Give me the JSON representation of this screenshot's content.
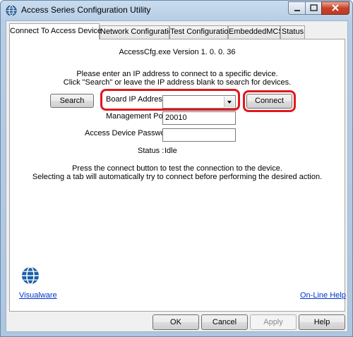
{
  "window": {
    "title": "Access Series Configuration Utility"
  },
  "tabs": [
    {
      "label": "Connect To Access Device"
    },
    {
      "label": "Network Configuration"
    },
    {
      "label": "Test Configuration"
    },
    {
      "label": "EmbeddedMCS"
    },
    {
      "label": "Status"
    }
  ],
  "connect": {
    "version": "AccessCfg.exe Version 1. 0. 0. 36",
    "instructions_1": "Please enter an IP address to connect to a specific device.",
    "instructions_2": "Click \"Search\" or leave the IP address blank to search for devices.",
    "search_label": "Search",
    "board_ip_label": "Board IP Address :",
    "board_ip_value": "",
    "connect_label": "Connect",
    "mgmt_port_label": "Management Port :",
    "mgmt_port_value": "20010",
    "password_label": "Access Device Password :",
    "password_value": "",
    "status_label": "Status :",
    "status_value": "Idle",
    "note_1": "Press the connect button to test the connection to the device.",
    "note_2": "Selecting a tab will automatically try to connect before performing the desired action.",
    "visualware_link": "Visualware",
    "help_link": "On-Line Help"
  },
  "footer": {
    "ok_label": "OK",
    "cancel_label": "Cancel",
    "apply_label": "Apply",
    "help_label": "Help"
  },
  "colors": {
    "highlight": "#e0181f",
    "link": "#0033cc",
    "logo": "#1b5fa8"
  }
}
